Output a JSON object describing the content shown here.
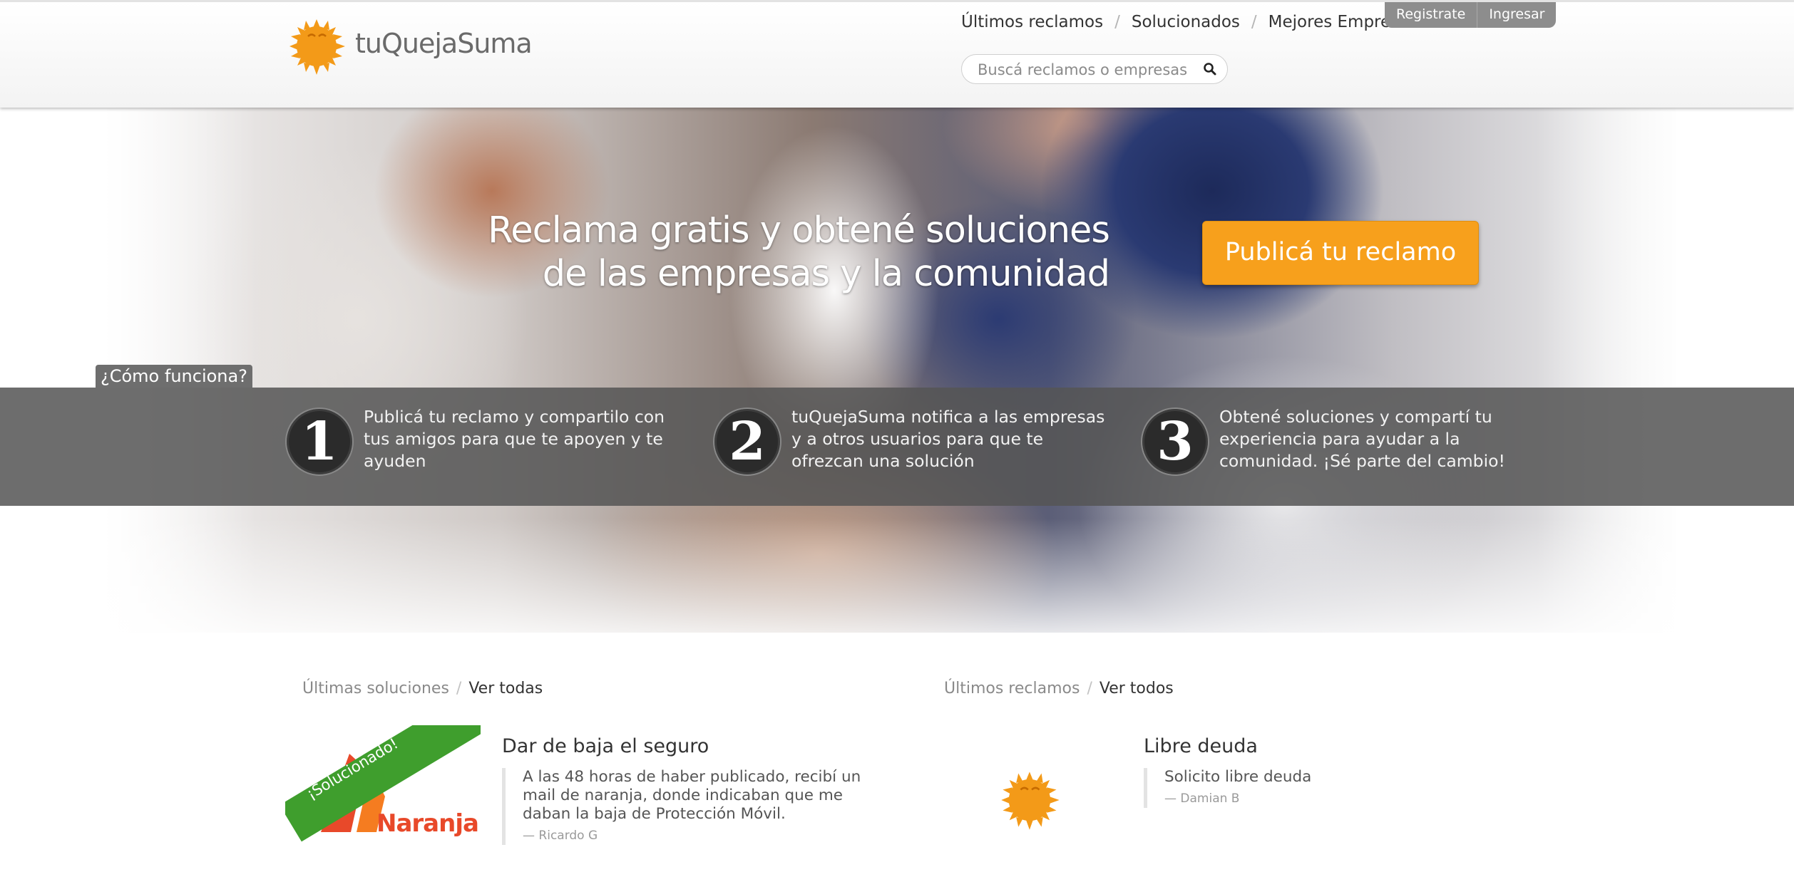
{
  "header": {
    "logo_text": "tuQuejaSuma",
    "nav": [
      "Últimos reclamos",
      "Solucionados",
      "Mejores Empresas"
    ],
    "register_label": "Registrate",
    "login_label": "Ingresar",
    "search_placeholder": "Buscá reclamos o empresas"
  },
  "hero": {
    "title_line1": "Reclama gratis y obtené soluciones",
    "title_line2": "de las empresas y la comunidad",
    "cta_label": "Publicá tu reclamo"
  },
  "how_it_works": {
    "tab_label": "¿Cómo funciona?",
    "steps": [
      {
        "number": "1",
        "text": "Publicá tu reclamo y compartilo con tus amigos para que te apoyen y te ayuden"
      },
      {
        "number": "2",
        "text": "tuQuejaSuma notifica a las empresas y a otros usuarios para que te ofrezcan una solución"
      },
      {
        "number": "3",
        "text": "Obtené soluciones y compartí tu experiencia para ayudar a la comunidad. ¡Sé parte del cambio!"
      }
    ]
  },
  "solutions": {
    "heading": "Últimas soluciones",
    "view_all": "Ver todas",
    "item": {
      "ribbon": "¡Solucionado!",
      "company_logo_text": "Naranja",
      "title": "Dar de baja el seguro",
      "text": "A las 48 horas de haber publicado, recibí un mail de naranja, donde indicaban que me daban la baja de Protección Móvil.",
      "author": "— Ricardo G"
    }
  },
  "complaints": {
    "heading": "Últimos reclamos",
    "view_all": "Ver todos",
    "item": {
      "title": "Libre deuda",
      "text": "Solicito libre deuda",
      "author": "— Damian B"
    }
  },
  "colors": {
    "brand_orange": "#f7a01c",
    "ribbon_green": "#3f9e2d",
    "steps_band": "#555555"
  },
  "icons": [
    "sun-logo-icon",
    "search-icon"
  ]
}
